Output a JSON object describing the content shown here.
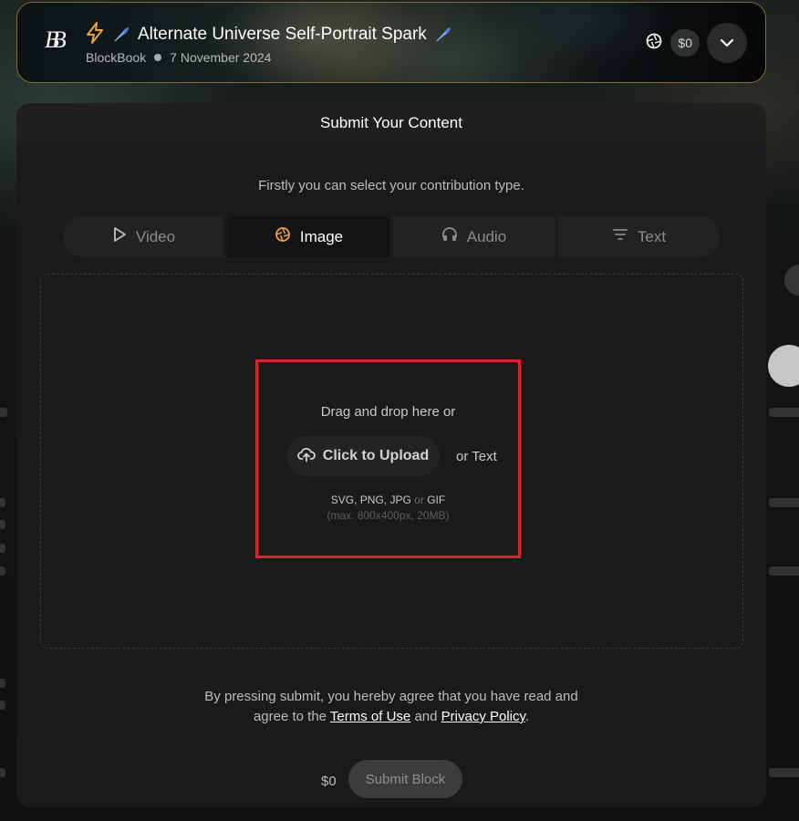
{
  "banner": {
    "title": "Alternate Universe Self-Portrait Spark",
    "author": "BlockBook",
    "date": "7 November 2024",
    "price": "$0",
    "logo_text": "BB",
    "accent_color": "#f0a232"
  },
  "modal": {
    "header": "Submit Your Content",
    "intro": "Firstly you can select your contribution type.",
    "tabs": [
      {
        "label": "Video",
        "icon": "play-icon",
        "active": false
      },
      {
        "label": "Image",
        "icon": "aperture-icon",
        "active": true
      },
      {
        "label": "Audio",
        "icon": "headphones-icon",
        "active": false
      },
      {
        "label": "Text",
        "icon": "text-lines-icon",
        "active": false
      }
    ],
    "upload": {
      "drag_text": "Drag and drop here or",
      "button_label": "Click to Upload",
      "or_text": "or Text",
      "formats_a": "SVG, PNG, JPG",
      "formats_or": "or",
      "formats_b": "GIF",
      "limits": "(max. 800x400px, 20MB)"
    },
    "agreement": {
      "line1": "By pressing submit, you hereby agree that you have read and",
      "line2_prefix": "agree to the",
      "terms_link": "Terms of Use",
      "and": "and",
      "privacy_link": "Privacy Policy",
      "suffix": "."
    },
    "footer": {
      "price": "$0",
      "submit_label": "Submit Block"
    }
  }
}
